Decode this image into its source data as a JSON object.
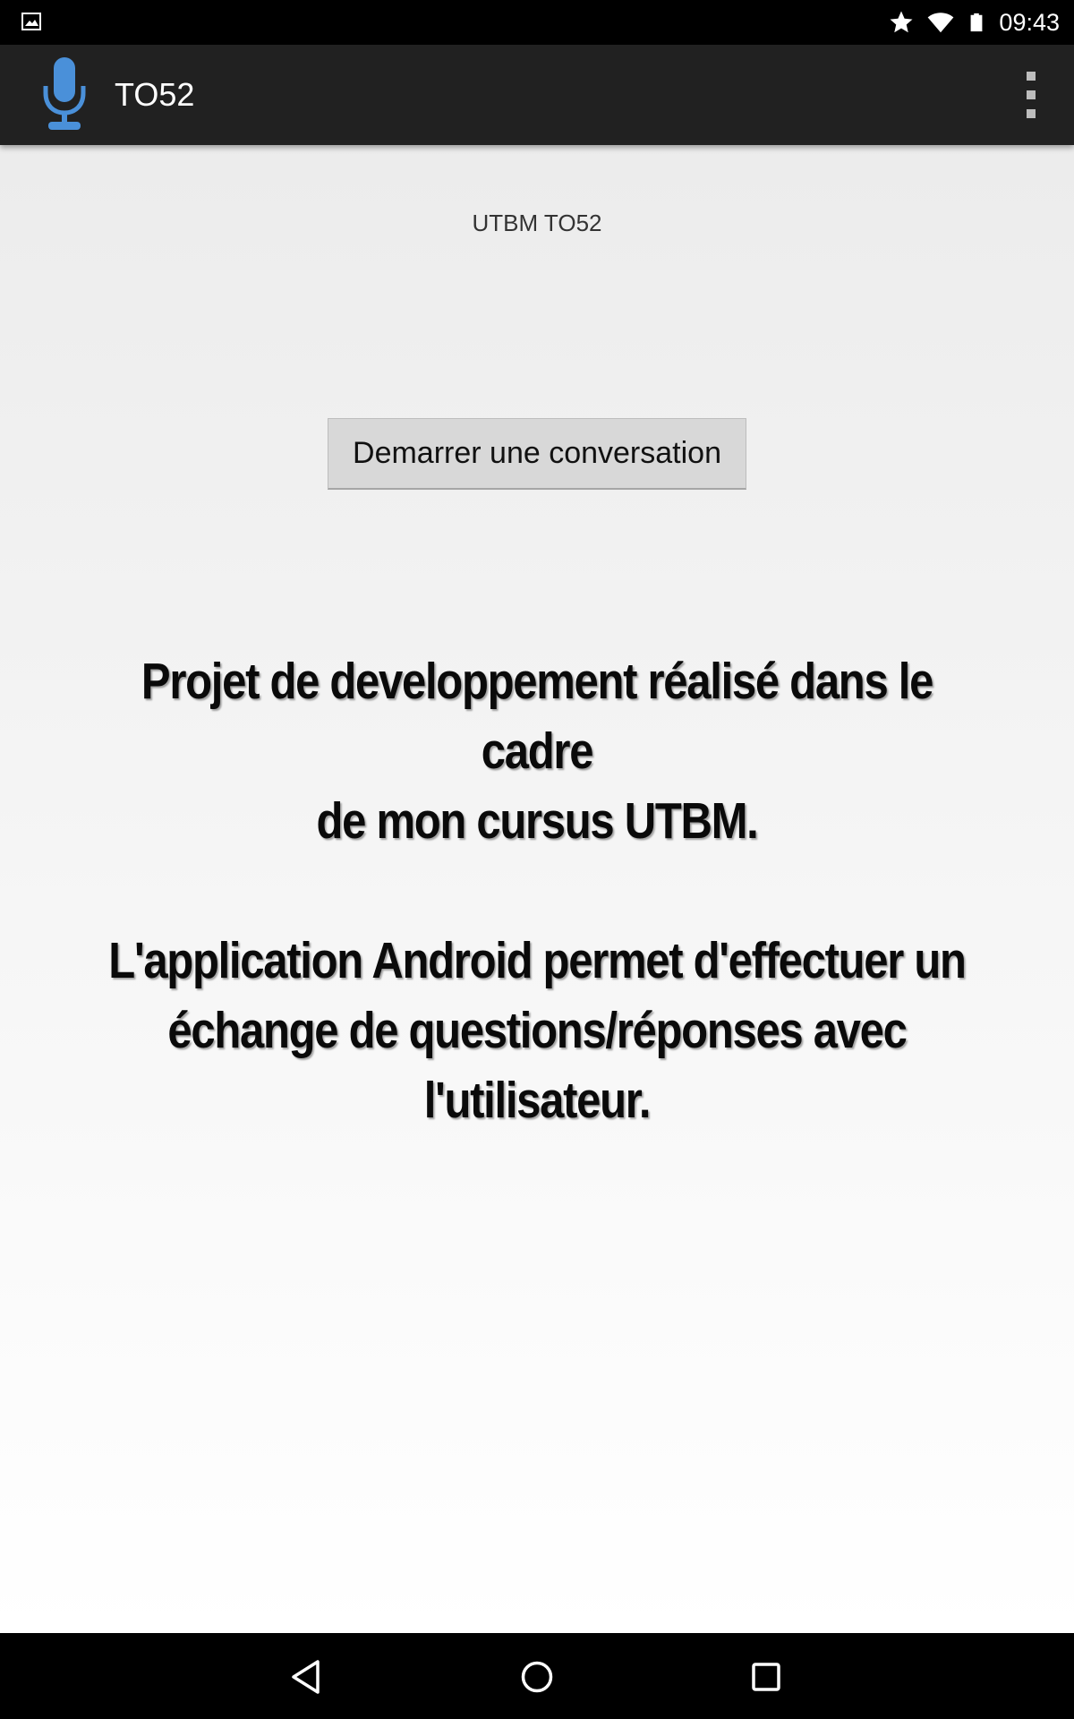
{
  "status_bar": {
    "time": "09:43",
    "icons": [
      "image-notification-icon",
      "star-icon",
      "wifi-icon",
      "battery-icon"
    ]
  },
  "action_bar": {
    "title": "TO52",
    "icon": "microphone-icon",
    "overflow_icon": "overflow-menu-icon",
    "accent_color": "#4a90d9"
  },
  "main": {
    "subtitle": "UTBM TO52",
    "start_button_label": "Demarrer une conversation",
    "description_1": "Projet de developpement réalisé dans le cadre\nde mon cursus UTBM.",
    "description_2": "L'application Android permet d'effectuer un\néchange de questions/réponses avec\nl'utilisateur."
  },
  "nav_bar": {
    "icons": [
      "back-icon",
      "home-icon",
      "recents-icon"
    ]
  }
}
